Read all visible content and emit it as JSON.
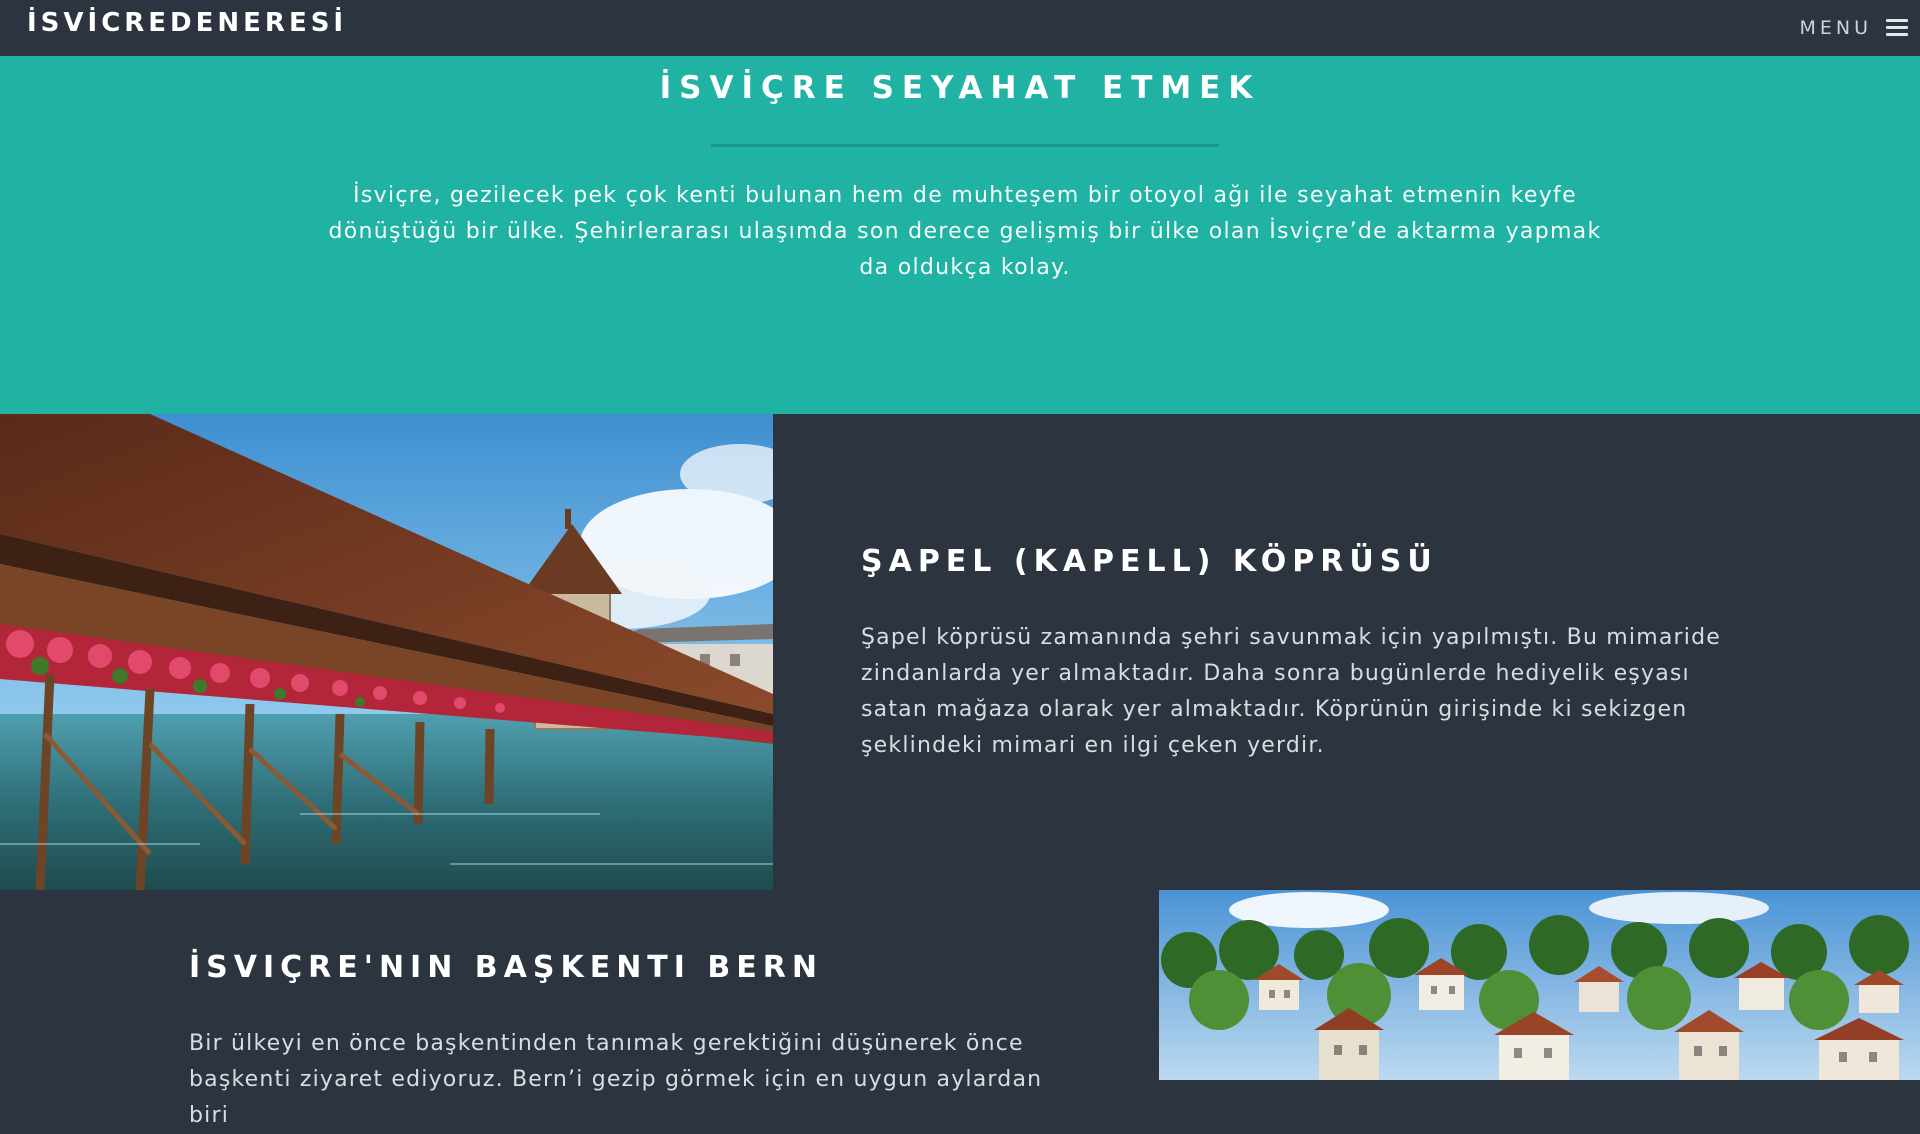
{
  "header": {
    "brand": "İSVİCREDENERESİ",
    "menu_label": "MENU"
  },
  "hero": {
    "title": "İSVİÇRE SEYAHAT ETMEK",
    "text": "İsviçre, gezilecek pek çok kenti bulunan hem de muhteşem bir otoyol ağı ile seyahat etmenin keyfe dönüştüğü bir ülke. Şehirlerarası ulaşımda son derece gelişmiş bir ülke olan İsviçre’de aktarma yapmak da oldukça kolay."
  },
  "sections": [
    {
      "title": "ŞAPEL (KAPELL) KÖPRÜSÜ",
      "text": "Şapel köprüsü zamanında şehri savunmak için yapılmıştı. Bu mimaride zindanlarda yer almaktadır. Daha sonra bugünlerde hediyelik eşyası satan mağaza olarak yer almaktadır. Köprünün girişinde ki sekizgen şeklindeki mimari en ilgi çeken yerdir."
    },
    {
      "title": "İSVIÇRE'NIN BAŞKENTI BERN",
      "text": "Bir ülkeyi en önce başkentinden tanımak gerektiğini düşünerek önce başkenti ziyaret ediyoruz. Bern’i gezip görmek için en uygun aylardan biri"
    }
  ],
  "colors": {
    "teal": "#20b3a4",
    "dark": "#2c3440"
  }
}
